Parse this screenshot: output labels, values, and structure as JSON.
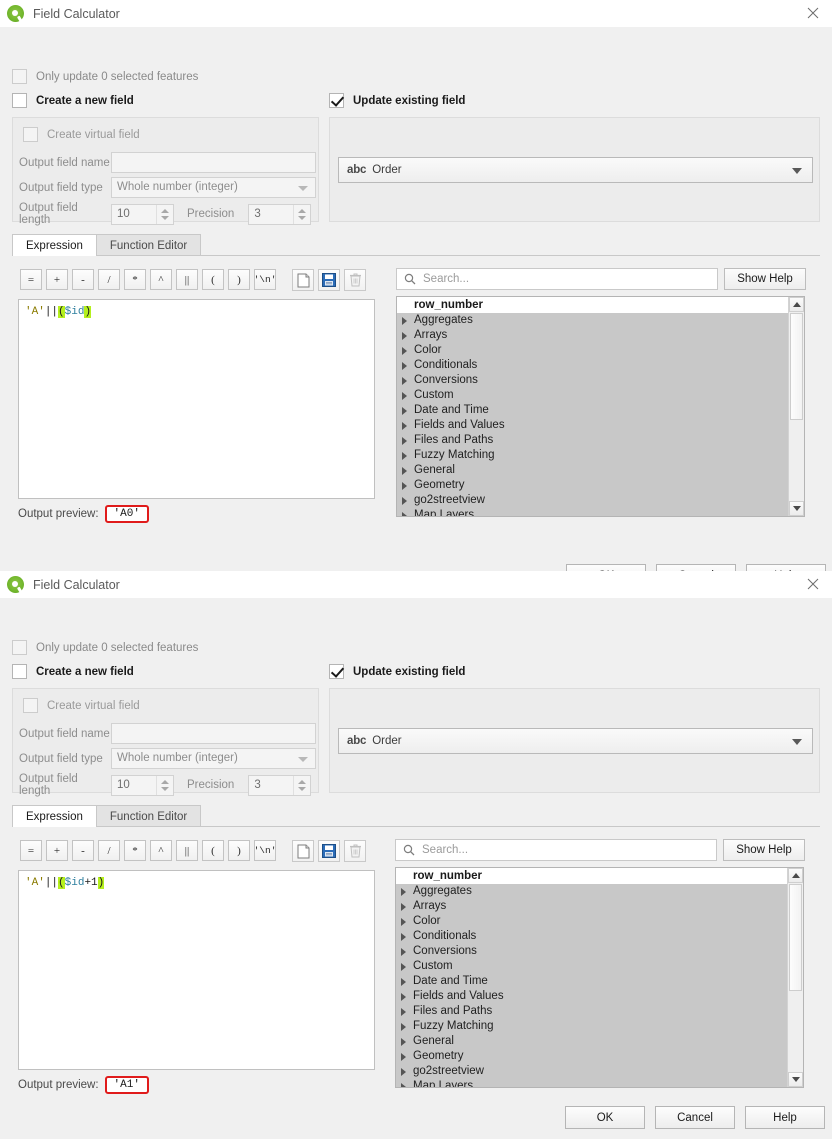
{
  "window": {
    "title": "Field Calculator",
    "logo_icon": "qgis-logo-icon",
    "close_icon": "close-icon"
  },
  "checkboxes": {
    "only_update": "Only update 0 selected features",
    "create_new_field": "Create a new field",
    "update_existing_field": "Update existing field",
    "create_virtual_field": "Create virtual field"
  },
  "new_field_form": {
    "name_label": "Output field name",
    "name_value": "",
    "type_label": "Output field type",
    "type_value": "Whole number (integer)",
    "length_label": "Output field length",
    "length_value": "10",
    "precision_label": "Precision",
    "precision_value": "3"
  },
  "existing_field": {
    "type_badge": "abc",
    "name": "Order"
  },
  "tabs": {
    "expression": "Expression",
    "function_editor": "Function Editor"
  },
  "operators": [
    {
      "label": "=",
      "name": "operator-equals"
    },
    {
      "label": "+",
      "name": "operator-plus"
    },
    {
      "label": "-",
      "name": "operator-minus"
    },
    {
      "label": "/",
      "name": "operator-divide"
    },
    {
      "label": "*",
      "name": "operator-multiply"
    },
    {
      "label": "^",
      "name": "operator-power"
    },
    {
      "label": "||",
      "name": "operator-concat"
    },
    {
      "label": "(",
      "name": "operator-open-paren"
    },
    {
      "label": ")",
      "name": "operator-close-paren"
    },
    {
      "label": "'\\n'",
      "name": "operator-newline"
    }
  ],
  "file_buttons": {
    "new": "new-document-icon",
    "save": "save-floppy-icon",
    "delete": "trash-icon"
  },
  "search": {
    "placeholder": "Search...",
    "icon": "search-icon"
  },
  "help_button": "Show Help",
  "function_tree": {
    "header": "row_number",
    "items": [
      "Aggregates",
      "Arrays",
      "Color",
      "Conditionals",
      "Conversions",
      "Custom",
      "Date and Time",
      "Fields and Values",
      "Files and Paths",
      "Fuzzy Matching",
      "General",
      "Geometry",
      "go2streetview",
      "Map Layers"
    ]
  },
  "dialog_buttons": {
    "ok": "OK",
    "cancel": "Cancel",
    "help": "Help"
  },
  "dialog_one": {
    "expression_parts": {
      "string": "'A'",
      "concat": "||",
      "open": "(",
      "variable": "$id",
      "close": ")"
    },
    "preview_label": "Output preview:",
    "preview_value": "'A0'"
  },
  "dialog_two": {
    "expression_parts": {
      "string": "'A'",
      "concat": "||",
      "open": "(",
      "variable": "$id",
      "plus": "+1",
      "close": ")"
    },
    "preview_label": "Output preview:",
    "preview_value": "'A1'"
  },
  "colors": {
    "highlight_green": "#b5f01e",
    "annotation_red": "#e01b1b",
    "accent_blue": "#2b6cb8",
    "qgis_green": "#74b82e"
  }
}
